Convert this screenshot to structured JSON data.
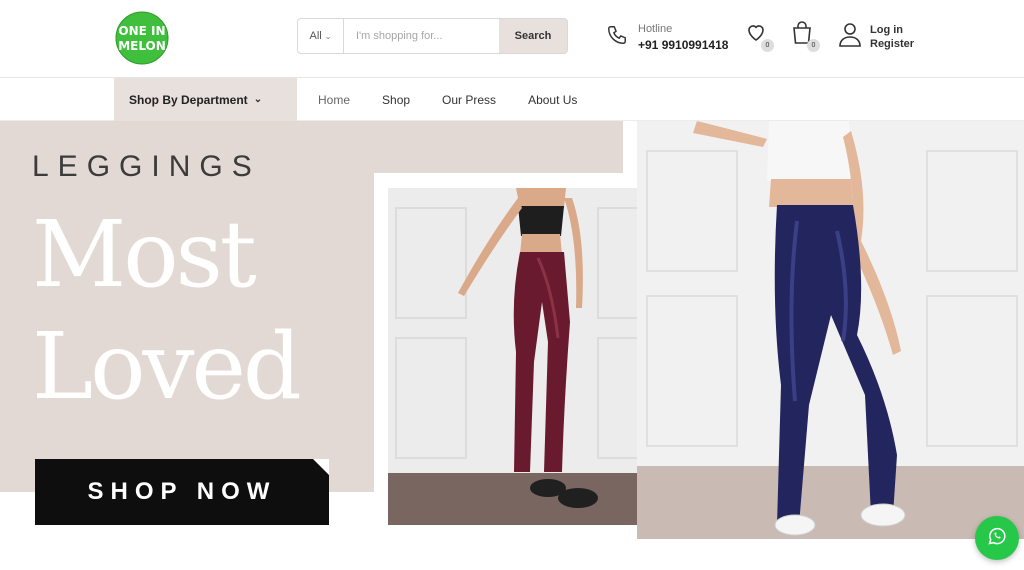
{
  "brand": {
    "logo_text_line1": "ONE IN",
    "logo_text_line2": "MELON",
    "logo_color": "#3fbf3c"
  },
  "search": {
    "category": "All",
    "placeholder": "I'm shopping for...",
    "value": "",
    "button_label": "Search"
  },
  "hotline": {
    "label": "Hotline",
    "number": "+91 9910991418",
    "icon": "phone-icon"
  },
  "wishlist": {
    "icon": "heart-icon",
    "count": "0"
  },
  "cart": {
    "icon": "shopping-bag-icon",
    "count": "0"
  },
  "account": {
    "icon": "user-icon",
    "login_label": "Log in",
    "register_label": "Register"
  },
  "nav": {
    "department_label": "Shop By Department",
    "items": [
      {
        "label": "Home"
      },
      {
        "label": "Shop"
      },
      {
        "label": "Our Press"
      },
      {
        "label": "About Us"
      }
    ]
  },
  "hero": {
    "subtitle": "LEGGINGS",
    "headline_line1": "Most",
    "headline_line2": "Loved",
    "cta_label": "SHOP NOW",
    "photo1_alt": "model wearing maroon leggings",
    "photo2_alt": "model wearing navy leggings"
  },
  "floating": {
    "icon": "whatsapp-icon"
  },
  "colors": {
    "accent_beige": "#e8e0dc",
    "hero_beige": "#e3d9d4",
    "cta_black": "#0e0e0e",
    "whatsapp_green": "#27c84a",
    "legging_maroon": "#6a1a2e",
    "legging_navy": "#23255e"
  }
}
